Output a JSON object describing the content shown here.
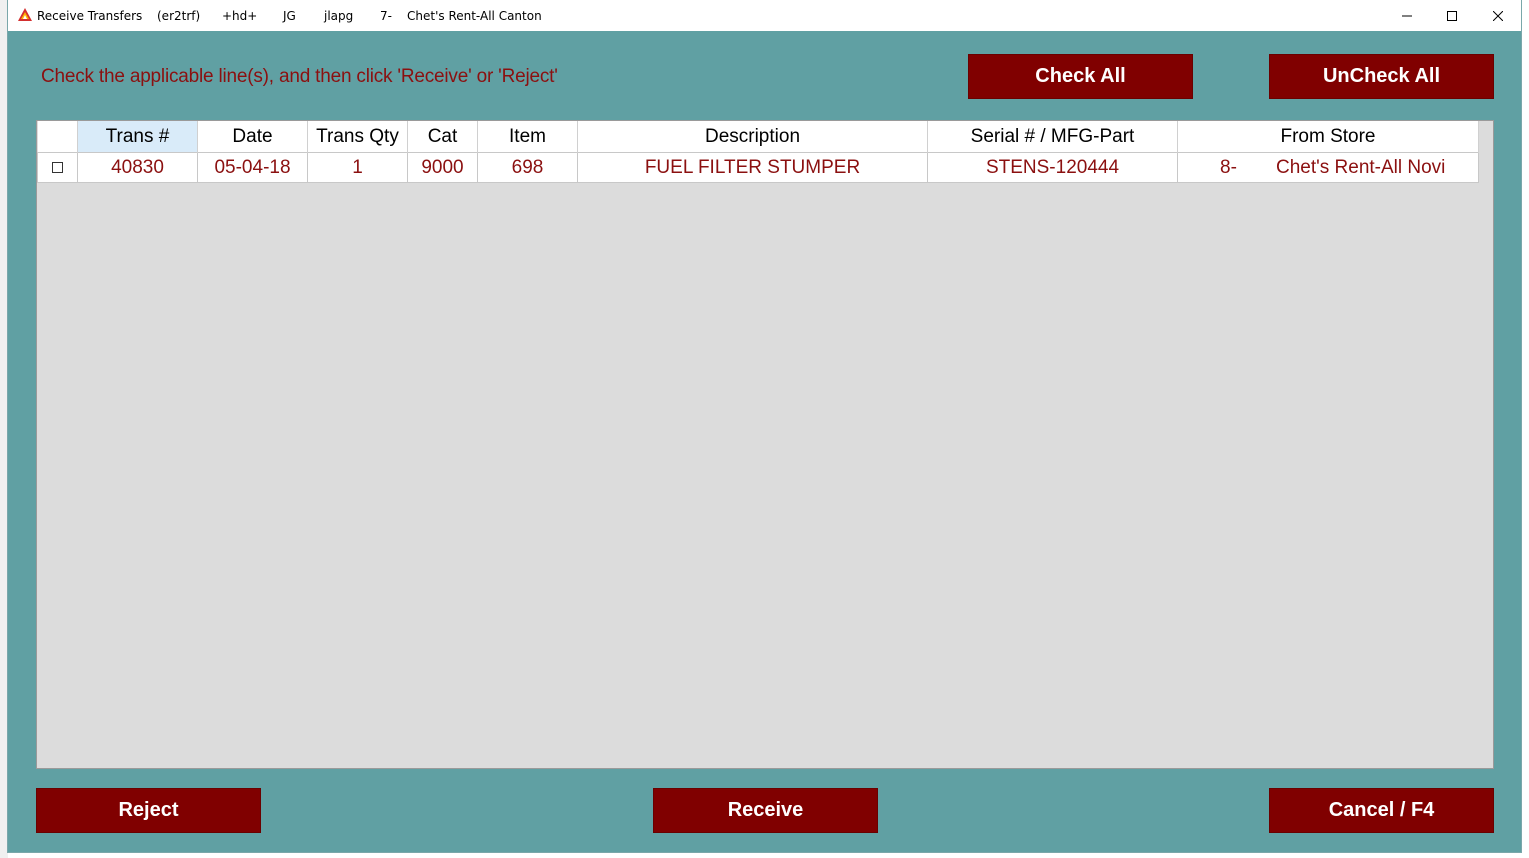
{
  "window": {
    "title_segments": [
      "Receive Transfers",
      "(er2trf)",
      "+hd+",
      "JG",
      "jlapg",
      "7-",
      "Chet's Rent-All Canton"
    ]
  },
  "instruction": "Check the applicable line(s), and then click 'Receive' or 'Reject'",
  "buttons": {
    "check_all": "Check All",
    "uncheck_all": "UnCheck All",
    "reject": "Reject",
    "receive": "Receive",
    "cancel": "Cancel / F4"
  },
  "grid": {
    "columns": [
      "Trans #",
      "Date",
      "Trans Qty",
      "Cat",
      "Item",
      "Description",
      "Serial # / MFG-Part",
      "From Store"
    ],
    "rows": [
      {
        "checked": false,
        "trans_no": "40830",
        "date": "05-04-18",
        "trans_qty": "1",
        "cat": "9000",
        "item": "698",
        "description": "FUEL FILTER STUMPER",
        "serial": "STENS-120444",
        "from_store_num": "8-",
        "from_store_name": "Chet's Rent-All Novi"
      }
    ]
  },
  "colors": {
    "window_bg": "#60a0a3",
    "button_bg": "#800000",
    "text_accent": "#8b1010"
  }
}
